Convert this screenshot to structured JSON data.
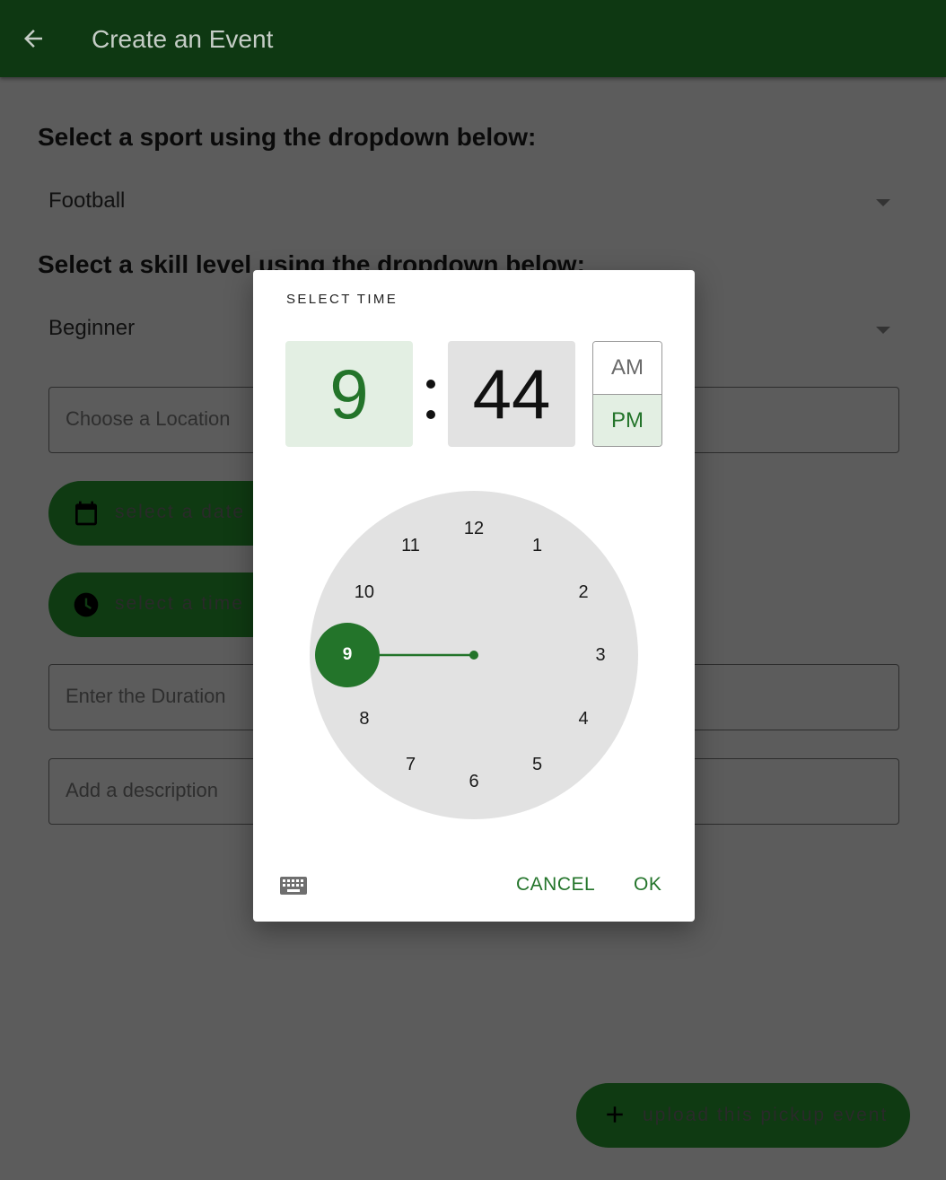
{
  "appbar": {
    "title": "Create an Event"
  },
  "form": {
    "sport_heading": "Select a sport using the dropdown below:",
    "sport_value": "Football",
    "skill_heading": "Select a skill level using the dropdown below:",
    "skill_value": "Beginner",
    "location_placeholder": "Choose a Location",
    "date_button": "select a date",
    "time_button": "select a time",
    "duration_placeholder": "Enter the Duration",
    "description_placeholder": "Add a description",
    "upload_button": "upload this pickup event"
  },
  "time_picker": {
    "title": "SELECT TIME",
    "hour": "9",
    "minute": "44",
    "am": "AM",
    "pm": "PM",
    "selected_period": "PM",
    "dial_numbers": [
      "12",
      "1",
      "2",
      "3",
      "4",
      "5",
      "6",
      "7",
      "8",
      "9",
      "10",
      "11"
    ],
    "selected_hour": 9,
    "cancel": "CANCEL",
    "ok": "OK"
  },
  "colors": {
    "appbar": "#0e3812",
    "accent": "#23742a",
    "scrim_bg": "#5c5c5c",
    "dial_bg": "#e2e2e2"
  },
  "icons": {
    "back": "arrow-back-icon",
    "calendar": "calendar-icon",
    "clock": "clock-icon",
    "add": "plus-icon",
    "keyboard": "keyboard-icon"
  }
}
